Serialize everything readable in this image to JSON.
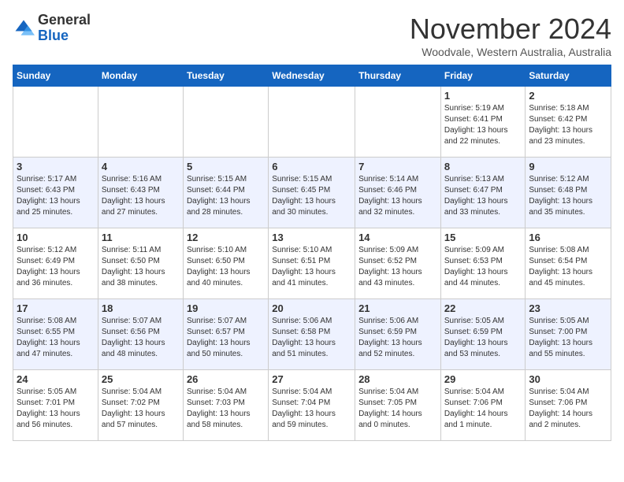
{
  "logo": {
    "general": "General",
    "blue": "Blue"
  },
  "title": "November 2024",
  "location": "Woodvale, Western Australia, Australia",
  "days_of_week": [
    "Sunday",
    "Monday",
    "Tuesday",
    "Wednesday",
    "Thursday",
    "Friday",
    "Saturday"
  ],
  "weeks": [
    [
      {
        "day": "",
        "info": ""
      },
      {
        "day": "",
        "info": ""
      },
      {
        "day": "",
        "info": ""
      },
      {
        "day": "",
        "info": ""
      },
      {
        "day": "",
        "info": ""
      },
      {
        "day": "1",
        "info": "Sunrise: 5:19 AM\nSunset: 6:41 PM\nDaylight: 13 hours\nand 22 minutes."
      },
      {
        "day": "2",
        "info": "Sunrise: 5:18 AM\nSunset: 6:42 PM\nDaylight: 13 hours\nand 23 minutes."
      }
    ],
    [
      {
        "day": "3",
        "info": "Sunrise: 5:17 AM\nSunset: 6:43 PM\nDaylight: 13 hours\nand 25 minutes."
      },
      {
        "day": "4",
        "info": "Sunrise: 5:16 AM\nSunset: 6:43 PM\nDaylight: 13 hours\nand 27 minutes."
      },
      {
        "day": "5",
        "info": "Sunrise: 5:15 AM\nSunset: 6:44 PM\nDaylight: 13 hours\nand 28 minutes."
      },
      {
        "day": "6",
        "info": "Sunrise: 5:15 AM\nSunset: 6:45 PM\nDaylight: 13 hours\nand 30 minutes."
      },
      {
        "day": "7",
        "info": "Sunrise: 5:14 AM\nSunset: 6:46 PM\nDaylight: 13 hours\nand 32 minutes."
      },
      {
        "day": "8",
        "info": "Sunrise: 5:13 AM\nSunset: 6:47 PM\nDaylight: 13 hours\nand 33 minutes."
      },
      {
        "day": "9",
        "info": "Sunrise: 5:12 AM\nSunset: 6:48 PM\nDaylight: 13 hours\nand 35 minutes."
      }
    ],
    [
      {
        "day": "10",
        "info": "Sunrise: 5:12 AM\nSunset: 6:49 PM\nDaylight: 13 hours\nand 36 minutes."
      },
      {
        "day": "11",
        "info": "Sunrise: 5:11 AM\nSunset: 6:50 PM\nDaylight: 13 hours\nand 38 minutes."
      },
      {
        "day": "12",
        "info": "Sunrise: 5:10 AM\nSunset: 6:50 PM\nDaylight: 13 hours\nand 40 minutes."
      },
      {
        "day": "13",
        "info": "Sunrise: 5:10 AM\nSunset: 6:51 PM\nDaylight: 13 hours\nand 41 minutes."
      },
      {
        "day": "14",
        "info": "Sunrise: 5:09 AM\nSunset: 6:52 PM\nDaylight: 13 hours\nand 43 minutes."
      },
      {
        "day": "15",
        "info": "Sunrise: 5:09 AM\nSunset: 6:53 PM\nDaylight: 13 hours\nand 44 minutes."
      },
      {
        "day": "16",
        "info": "Sunrise: 5:08 AM\nSunset: 6:54 PM\nDaylight: 13 hours\nand 45 minutes."
      }
    ],
    [
      {
        "day": "17",
        "info": "Sunrise: 5:08 AM\nSunset: 6:55 PM\nDaylight: 13 hours\nand 47 minutes."
      },
      {
        "day": "18",
        "info": "Sunrise: 5:07 AM\nSunset: 6:56 PM\nDaylight: 13 hours\nand 48 minutes."
      },
      {
        "day": "19",
        "info": "Sunrise: 5:07 AM\nSunset: 6:57 PM\nDaylight: 13 hours\nand 50 minutes."
      },
      {
        "day": "20",
        "info": "Sunrise: 5:06 AM\nSunset: 6:58 PM\nDaylight: 13 hours\nand 51 minutes."
      },
      {
        "day": "21",
        "info": "Sunrise: 5:06 AM\nSunset: 6:59 PM\nDaylight: 13 hours\nand 52 minutes."
      },
      {
        "day": "22",
        "info": "Sunrise: 5:05 AM\nSunset: 6:59 PM\nDaylight: 13 hours\nand 53 minutes."
      },
      {
        "day": "23",
        "info": "Sunrise: 5:05 AM\nSunset: 7:00 PM\nDaylight: 13 hours\nand 55 minutes."
      }
    ],
    [
      {
        "day": "24",
        "info": "Sunrise: 5:05 AM\nSunset: 7:01 PM\nDaylight: 13 hours\nand 56 minutes."
      },
      {
        "day": "25",
        "info": "Sunrise: 5:04 AM\nSunset: 7:02 PM\nDaylight: 13 hours\nand 57 minutes."
      },
      {
        "day": "26",
        "info": "Sunrise: 5:04 AM\nSunset: 7:03 PM\nDaylight: 13 hours\nand 58 minutes."
      },
      {
        "day": "27",
        "info": "Sunrise: 5:04 AM\nSunset: 7:04 PM\nDaylight: 13 hours\nand 59 minutes."
      },
      {
        "day": "28",
        "info": "Sunrise: 5:04 AM\nSunset: 7:05 PM\nDaylight: 14 hours\nand 0 minutes."
      },
      {
        "day": "29",
        "info": "Sunrise: 5:04 AM\nSunset: 7:06 PM\nDaylight: 14 hours\nand 1 minute."
      },
      {
        "day": "30",
        "info": "Sunrise: 5:04 AM\nSunset: 7:06 PM\nDaylight: 14 hours\nand 2 minutes."
      }
    ]
  ]
}
